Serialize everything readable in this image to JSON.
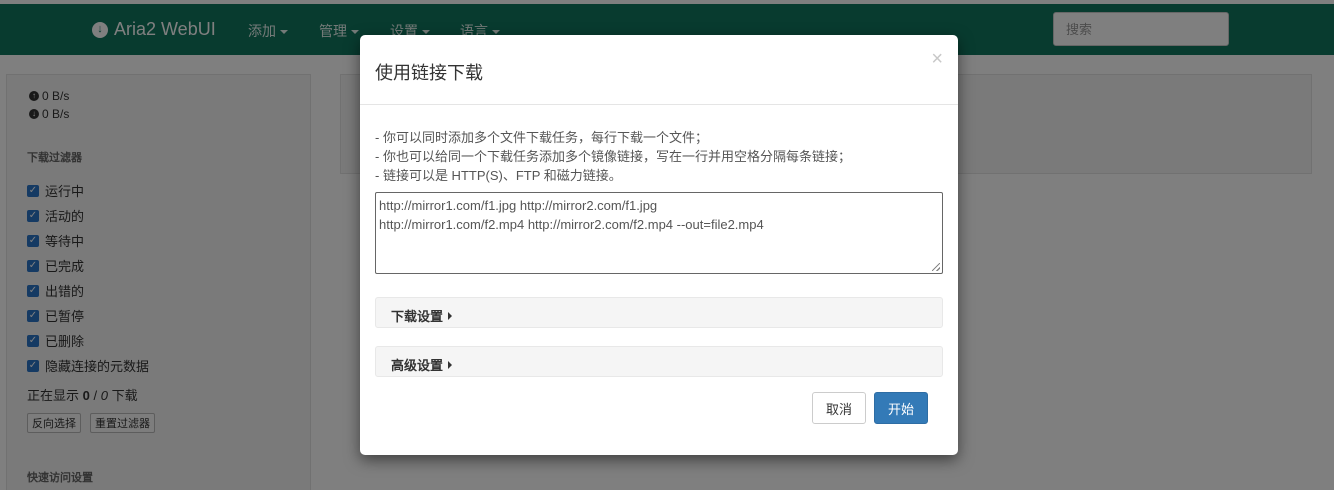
{
  "navbar": {
    "brand": "Aria2 WebUI",
    "menus": [
      "添加",
      "管理",
      "设置",
      "语言"
    ],
    "search_placeholder": "搜索"
  },
  "sidebar": {
    "upload_speed": "0 B/s",
    "download_speed": "0 B/s",
    "filter_heading": "下载过滤器",
    "filters": [
      {
        "label": "运行中",
        "checked": true
      },
      {
        "label": "活动的",
        "checked": true
      },
      {
        "label": "等待中",
        "checked": true
      },
      {
        "label": "已完成",
        "checked": true
      },
      {
        "label": "出错的",
        "checked": true
      },
      {
        "label": "已暂停",
        "checked": true
      },
      {
        "label": "已删除",
        "checked": true
      },
      {
        "label": "隐藏连接的元数据",
        "checked": true
      }
    ],
    "showing_prefix": "正在显示",
    "showing_count": "0",
    "showing_sep": "/",
    "showing_total": "0",
    "showing_suffix": "下载",
    "invert_button": "反向选择",
    "reset_button": "重置过滤器",
    "quick_heading": "快速访问设置"
  },
  "modal": {
    "title": "使用链接下载",
    "close_glyph": "×",
    "tips": [
      "- 你可以同时添加多个文件下载任务，每行下载一个文件；",
      "- 你也可以给同一个下载任务添加多个镜像链接，写在一行并用空格分隔每条链接；",
      "- 链接可以是 HTTP(S)、FTP 和磁力链接。"
    ],
    "placeholder_lines": [
      "http://mirror1.com/f1.jpg http://mirror2.com/f1.jpg",
      "http://mirror1.com/f2.mp4 http://mirror2.com/f2.mp4 --out=file2.mp4"
    ],
    "download_settings": "下载设置",
    "advanced_settings": "高级设置",
    "cancel_button": "取消",
    "start_button": "开始"
  },
  "colors": {
    "navbar": "#11765f",
    "primary": "#337ab7",
    "checkbox": "#2a75c7"
  }
}
